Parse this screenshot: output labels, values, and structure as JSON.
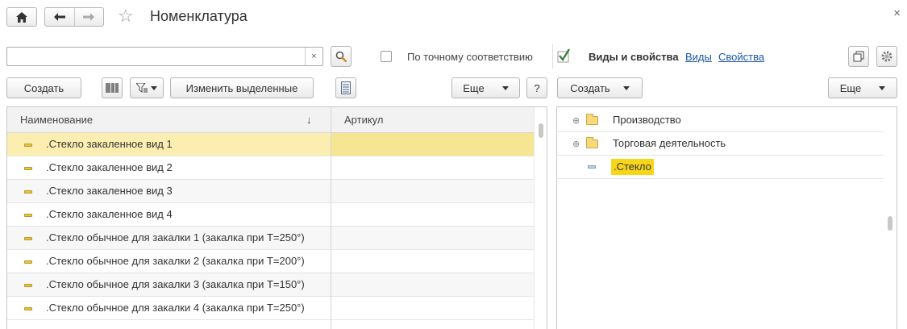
{
  "header": {
    "title": "Номенклатура",
    "close_glyph": "×"
  },
  "search": {
    "value": "",
    "clear_glyph": "×"
  },
  "filters": {
    "exact_match_label": "По точному соответствию",
    "exact_match_checked": false,
    "kinds_checked": true,
    "kinds_label": "Виды и свойства",
    "kinds_link": "Виды",
    "props_link": "Свойства"
  },
  "toolbar_left": {
    "create_label": "Создать",
    "edit_selected_label": "Изменить выделенные",
    "more_label": "Еще",
    "help_label": "?"
  },
  "toolbar_right": {
    "create_label": "Создать",
    "more_label": "Еще"
  },
  "table": {
    "columns": [
      "Наименование",
      "Артикул"
    ],
    "sort_indicator": "↓",
    "rows": [
      {
        "name": ".Стекло закаленное вид 1",
        "article": ""
      },
      {
        "name": ".Стекло закаленное вид 2",
        "article": ""
      },
      {
        "name": ".Стекло закаленное вид 3",
        "article": ""
      },
      {
        "name": ".Стекло закаленное вид 4",
        "article": ""
      },
      {
        "name": ".Стекло обычное для закалки 1 (закалка при Т=250°)",
        "article": ""
      },
      {
        "name": ".Стекло обычное для закалки 2 (закалка при Т=200°)",
        "article": ""
      },
      {
        "name": ".Стекло обычное для закалки 3 (закалка при Т=150°)",
        "article": ""
      },
      {
        "name": ".Стекло обычное для закалки 4 (закалка при Т=250°)",
        "article": ""
      }
    ]
  },
  "tree": {
    "items": [
      {
        "name": "Производство",
        "expander": "⊕"
      },
      {
        "name": "Торговая деятельность",
        "expander": "⊕"
      },
      {
        "name": ".Стекло",
        "expander": ""
      }
    ]
  },
  "colors": {
    "selected_row": "#fbeeb0",
    "tree_highlight": "#f7d61a",
    "link": "#1a56a8",
    "check": "#2e7d32"
  }
}
